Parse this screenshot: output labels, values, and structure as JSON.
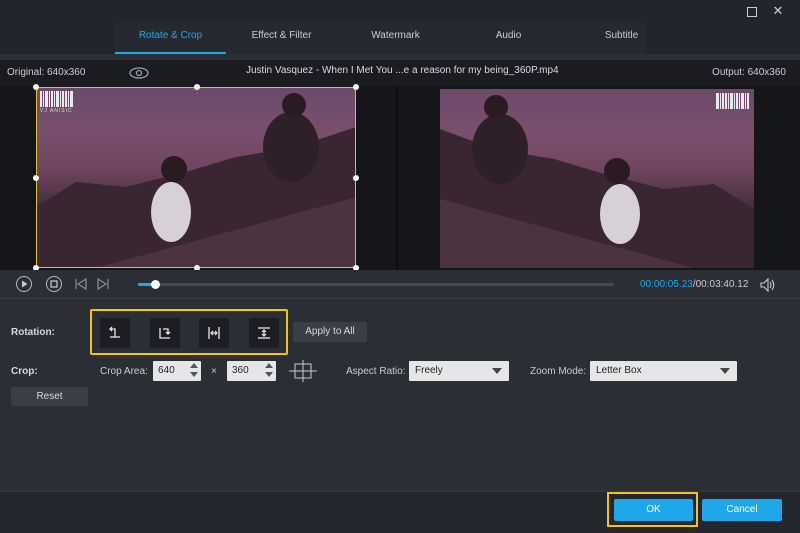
{
  "window": {
    "maximize_label": "",
    "close_label": "✕"
  },
  "tabs": [
    "Rotate & Crop",
    "Effect & Filter",
    "Watermark",
    "Audio",
    "Subtitle"
  ],
  "active_tab": "Rotate & Crop",
  "info": {
    "original": "Original: 640x360",
    "filename": "Justin Vasquez - When I Met You ...e a reason for my being_360P.mp4",
    "output": "Output: 640x360"
  },
  "playback": {
    "current_time": "00:00:05.23",
    "total_time": "/00:03:40.12",
    "progress": 0.035
  },
  "watermark_text": "VJ ANISIC",
  "rotation": {
    "label": "Rotation:",
    "buttons": [
      "rotate-left-icon",
      "rotate-right-icon",
      "flip-horizontal-icon",
      "flip-vertical-icon"
    ],
    "apply_all": "Apply to All"
  },
  "crop": {
    "label": "Crop:",
    "area_label": "Crop Area:",
    "width": "640",
    "height": "360",
    "times": "×",
    "aspect_label": "Aspect Ratio:",
    "aspect_value": "Freely",
    "zoom_label": "Zoom Mode:",
    "zoom_value": "Letter Box",
    "reset": "Reset"
  },
  "footer": {
    "ok": "OK",
    "cancel": "Cancel"
  },
  "colors": {
    "accent": "#1fa9ea",
    "highlight": "#f2c418",
    "crop_border": "#e3c02a"
  }
}
